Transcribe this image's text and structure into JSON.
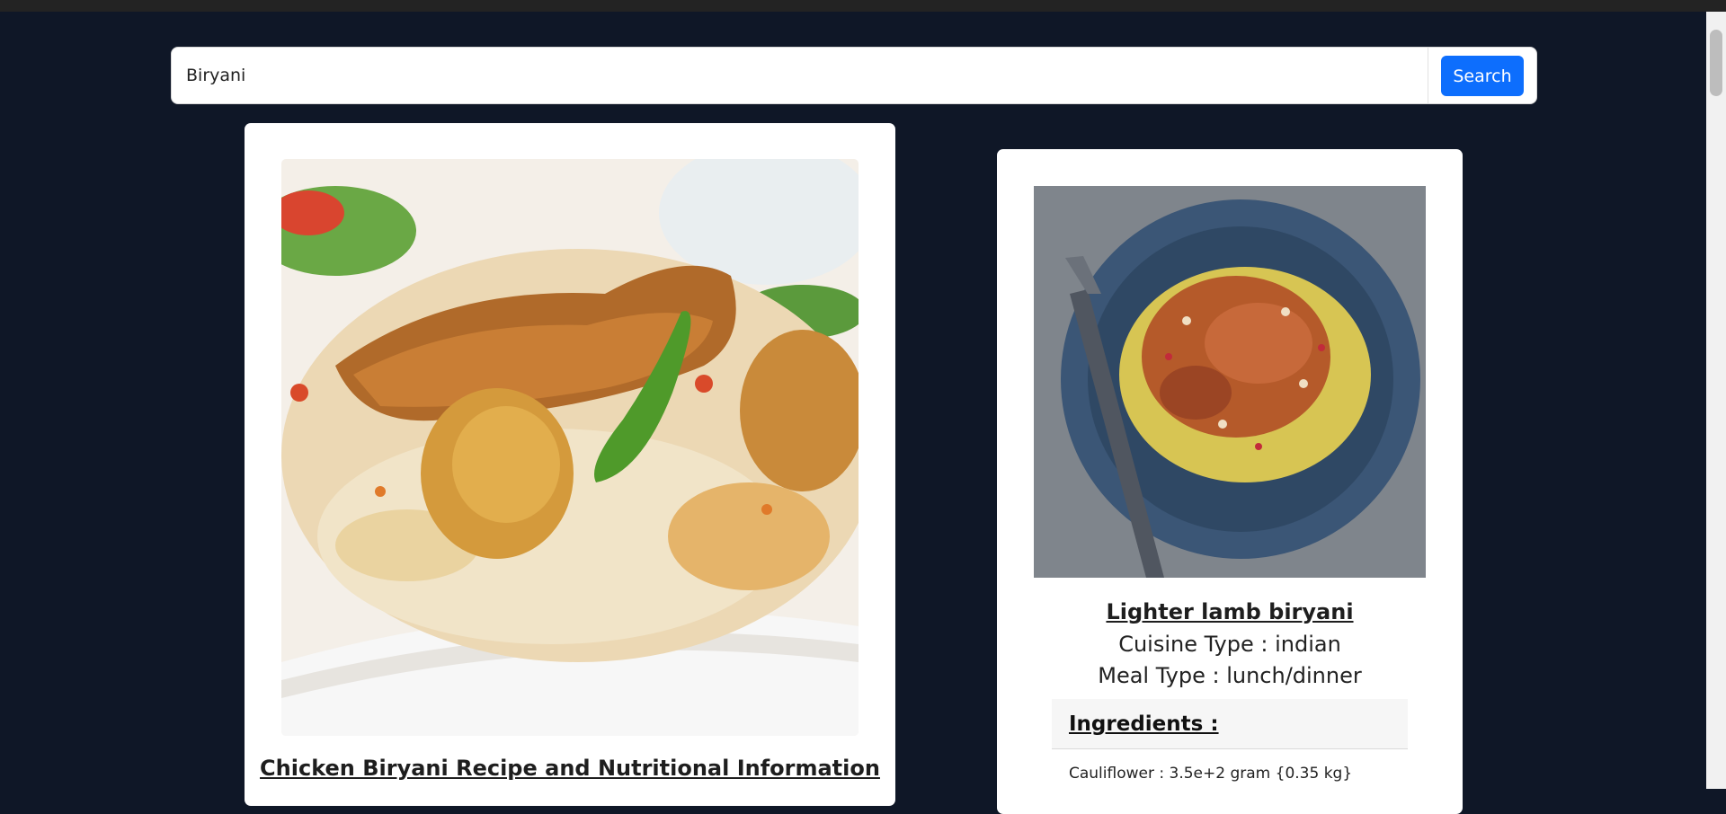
{
  "search": {
    "value": "Biryani",
    "button_label": "Search"
  },
  "recipes": [
    {
      "title": "Chicken Biryani Recipe and Nutritional Information",
      "image": "chicken biryani with rice, chicken leg and green chili"
    },
    {
      "title": "Lighter lamb biryani",
      "cuisine_type": "Cuisine Type : indian",
      "meal_type": "Meal Type : lunch/dinner",
      "ingredients_heading": "Ingredients :",
      "ingredients": [
        "Cauliflower : 3.5e+2 gram {0.35 kg}"
      ],
      "image": "lamb biryani on blue plate with fork, almonds and pomegranate"
    }
  ],
  "colors": {
    "background": "#0f1727",
    "accent": "#0d6efd"
  }
}
